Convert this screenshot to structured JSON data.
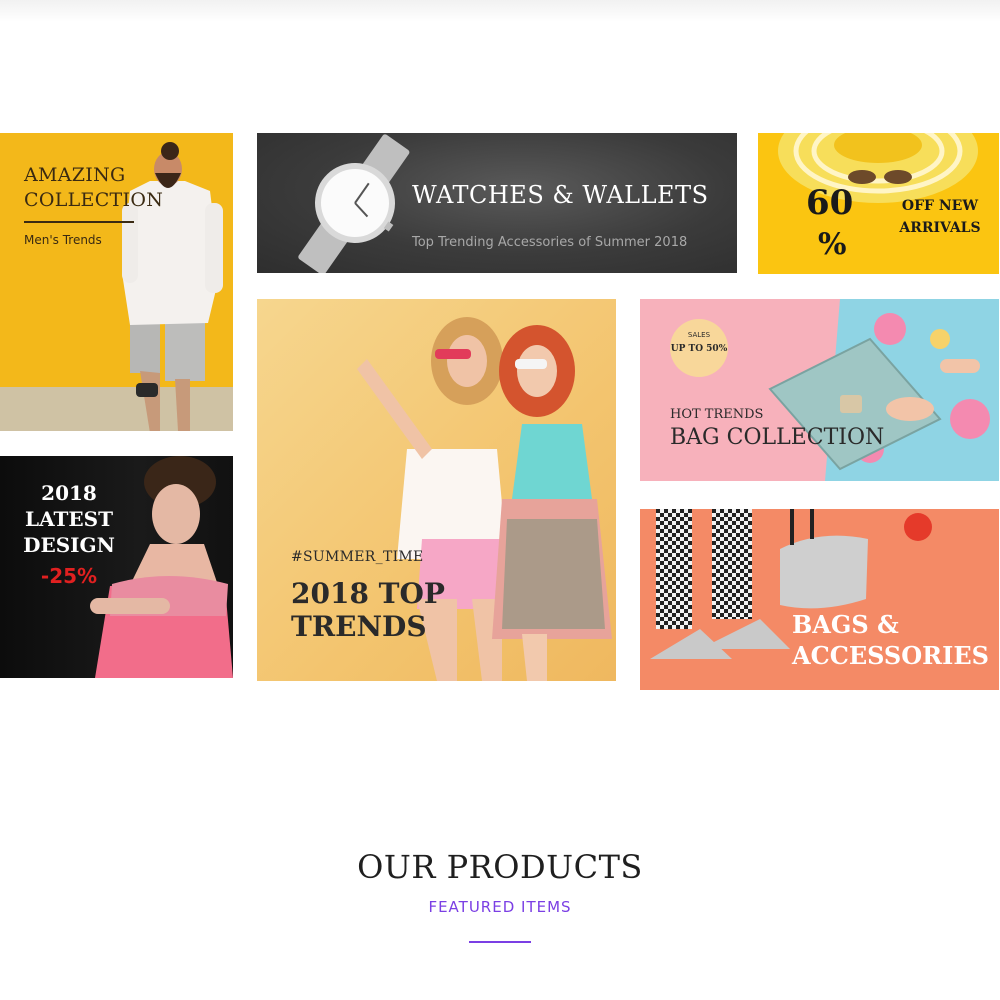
{
  "banners": {
    "amazing": {
      "title": "AMAZING COLLECTION",
      "subtitle": "Men's Trends"
    },
    "watches": {
      "title": "WATCHES & WALLETS",
      "subtitle": "Top Trending Accessories of Summer 2018"
    },
    "sale60": {
      "number": "60",
      "percent": "%",
      "text": "OFF NEW ARRIVALS"
    },
    "latest": {
      "title": "2018 LATEST DESIGN",
      "discount": "-25%"
    },
    "summer": {
      "tag": "#SUMMER_TIME",
      "title": "2018 TOP TRENDS"
    },
    "bags": {
      "badge_small": "SALES",
      "badge_main": "UP TO 50%",
      "kicker": "HOT TRENDS",
      "title": "BAG COLLECTION"
    },
    "accessories": {
      "title": "BAGS & ACCESSORIES"
    }
  },
  "section": {
    "title": "OUR PRODUCTS",
    "subtitle": "FEATURED ITEMS"
  },
  "colors": {
    "accent": "#7b3fe4",
    "sale_red": "#e02020",
    "yellow": "#f3b81a",
    "pink": "#f7b1bb",
    "coral": "#f48a66"
  }
}
